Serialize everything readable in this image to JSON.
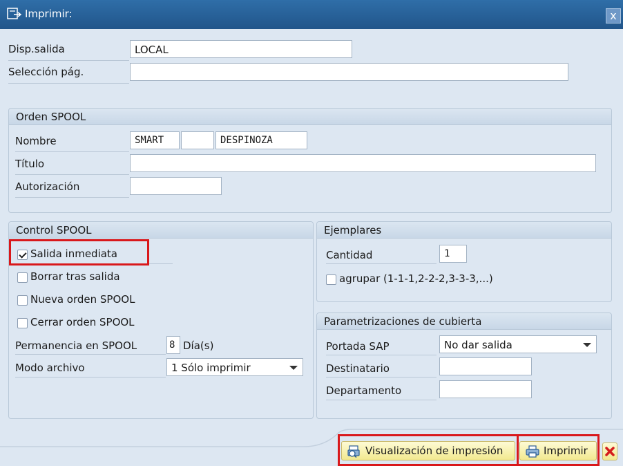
{
  "window": {
    "title": "Imprimir:",
    "close_label": "x"
  },
  "main": {
    "output_device": {
      "label": "Disp.salida",
      "value": "LOCAL"
    },
    "page_selection": {
      "label": "Selección pág.",
      "value": ""
    }
  },
  "spool_request": {
    "title": "Orden SPOOL",
    "name": {
      "label": "Nombre",
      "value1": "SMART",
      "value2": "",
      "value3": "DESPINOZA"
    },
    "titulo": {
      "label": "Título",
      "value": ""
    },
    "authorization": {
      "label": "Autorización",
      "value": ""
    }
  },
  "spool_control": {
    "title": "Control SPOOL",
    "checkboxes": [
      {
        "label": "Salida inmediata",
        "checked": true
      },
      {
        "label": "Borrar tras salida",
        "checked": false
      },
      {
        "label": "Nueva orden SPOOL",
        "checked": false
      },
      {
        "label": "Cerrar orden SPOOL",
        "checked": false
      }
    ],
    "retention": {
      "label": "Permanencia en SPOOL",
      "value": "8",
      "unit": "Día(s)"
    },
    "archive_mode": {
      "label": "Modo archivo",
      "value": "1 Sólo imprimir"
    }
  },
  "copies": {
    "title": "Ejemplares",
    "quantity": {
      "label": "Cantidad",
      "value": "1"
    },
    "group": {
      "label": "agrupar (1-1-1,2-2-2,3-3-3,...)",
      "checked": false
    }
  },
  "cover": {
    "title": "Parametrizaciones de cubierta",
    "sap_cover": {
      "label": "Portada SAP",
      "value": "No dar salida"
    },
    "recipient": {
      "label": "Destinatario",
      "value": ""
    },
    "department": {
      "label": "Departamento",
      "value": ""
    }
  },
  "footer": {
    "preview_label": "Visualización de impresión",
    "print_label": "Imprimir"
  },
  "colors": {
    "highlight": "#d9181b",
    "titlebar": "#21558a",
    "background": "#dde7f2"
  }
}
